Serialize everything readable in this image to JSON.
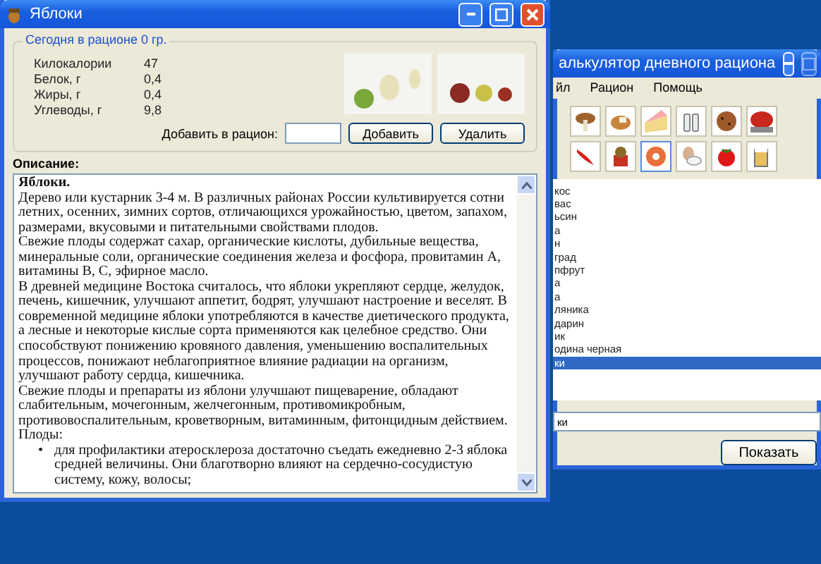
{
  "front_window": {
    "title": "Яблоки",
    "summary": {
      "legend": "Сегодня в рационе 0 гр.",
      "nutrients": [
        {
          "name": "Килокалории",
          "value": "47"
        },
        {
          "name": "Белок, г",
          "value": "0,4"
        },
        {
          "name": "Жиры, г",
          "value": "0,4"
        },
        {
          "name": "Углеводы, г",
          "value": "9,8"
        }
      ]
    },
    "add": {
      "label": "Добавить в рацион:",
      "buttons": [
        "Добавить",
        "Удалить"
      ]
    },
    "description": {
      "label": "Описание:",
      "title": "Яблоки.",
      "paragraphs": [
        "Дерево или кустарник 3-4 м. В различных районах России культивируется сотни летних, осенних, зимних сортов, отличающихся урожайностью, цветом, запахом, размерами, вкусовыми и питательными свойствами плодов.",
        "Свежие плоды содержат сахар, органические кислоты, дубильные вещества, минеральные соли, органические соединения железа и фосфора, провитамин А, витамины В, С, эфирное масло.",
        "В древней медицине Востока считалось, что яблоки укрепляют сердце, желудок, печень, кишечник, улучшают аппетит, бодрят, улучшают настроение и веселят. В современной медицине яблоки употребляются в качестве диетического продукта, а лесные и некоторые кислые сорта применяются как целебное средство. Они способствуют понижению кровяного давления, уменьшению воспалительных процессов, понижают неблагоприятное влияние радиации на организм, улучшают работу сердца, кишечника.",
        "Свежие плоды и препараты из яблони улучшают пищеварение, обладают слабительным, мочегонным, желчегонным, противомикробным, противовоспалительным, кроветворным, витаминным, фитонцидным действием.",
        "Плоды:"
      ],
      "bullet_marker": "•",
      "bullets": [
        "для профилактики атеросклероза достаточно съедать ежедневно 2-3 яблока средней величины. Они благотворно влияют на сердечно-сосудистую систему, кожу, волосы;"
      ]
    }
  },
  "back_window": {
    "title": "алькулятор дневного рациона",
    "menu": [
      "йл",
      "Рацион",
      "Помощь"
    ],
    "toolbar_rows": [
      [
        {
          "kind": "mushroom",
          "selected": false
        },
        {
          "kind": "pie",
          "selected": false
        },
        {
          "kind": "cake",
          "selected": false
        },
        {
          "kind": "bottles",
          "selected": false
        },
        {
          "kind": "cookie",
          "selected": false
        },
        {
          "kind": "chicken",
          "selected": false
        }
      ],
      [
        {
          "kind": "pepper",
          "selected": false
        },
        {
          "kind": "basket",
          "selected": false
        },
        {
          "kind": "donut",
          "selected": true
        },
        {
          "kind": "eggs",
          "selected": false
        },
        {
          "kind": "tomato",
          "selected": false
        },
        {
          "kind": "mug",
          "selected": false
        }
      ]
    ],
    "list": [
      {
        "label": "кос",
        "selected": false
      },
      {
        "label": "вас",
        "selected": false
      },
      {
        "label": "ьсин",
        "selected": false
      },
      {
        "label": "а",
        "selected": false
      },
      {
        "label": "н",
        "selected": false
      },
      {
        "label": "град",
        "selected": false
      },
      {
        "label": "пфрут",
        "selected": false
      },
      {
        "label": "а",
        "selected": false
      },
      {
        "label": "а",
        "selected": false
      },
      {
        "label": "ляника",
        "selected": false
      },
      {
        "label": "дарин",
        "selected": false
      },
      {
        "label": "ик",
        "selected": false
      },
      {
        "label": "одина черная",
        "selected": false
      },
      {
        "label": "ки",
        "selected": true
      }
    ],
    "search_value": "ки",
    "button": "Показать"
  }
}
